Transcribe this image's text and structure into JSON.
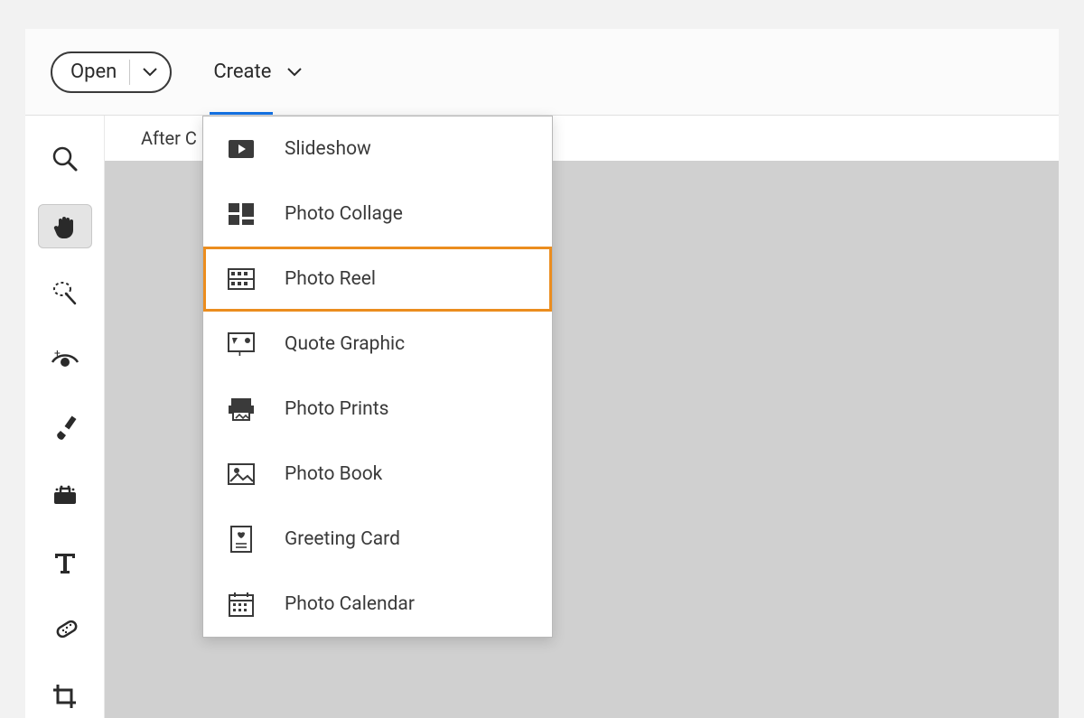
{
  "topbar": {
    "open_label": "Open",
    "create_label": "Create"
  },
  "document_tab": "After C",
  "toolbar": [
    {
      "name": "zoom-tool-icon"
    },
    {
      "name": "hand-tool-icon",
      "selected": true
    },
    {
      "name": "quick-select-tool-icon"
    },
    {
      "name": "eye-tool-icon"
    },
    {
      "name": "brush-tool-icon"
    },
    {
      "name": "toolbox-tool-icon"
    },
    {
      "name": "type-tool-icon"
    },
    {
      "name": "healing-tool-icon"
    },
    {
      "name": "crop-tool-icon"
    }
  ],
  "create_menu": [
    {
      "icon": "slideshow-icon",
      "label": "Slideshow"
    },
    {
      "icon": "collage-icon",
      "label": "Photo Collage"
    },
    {
      "icon": "reel-icon",
      "label": "Photo Reel",
      "highlight": true
    },
    {
      "icon": "quote-icon",
      "label": "Quote Graphic"
    },
    {
      "icon": "prints-icon",
      "label": "Photo Prints"
    },
    {
      "icon": "book-icon",
      "label": "Photo Book"
    },
    {
      "icon": "card-icon",
      "label": "Greeting Card"
    },
    {
      "icon": "calendar-icon",
      "label": "Photo Calendar"
    }
  ]
}
